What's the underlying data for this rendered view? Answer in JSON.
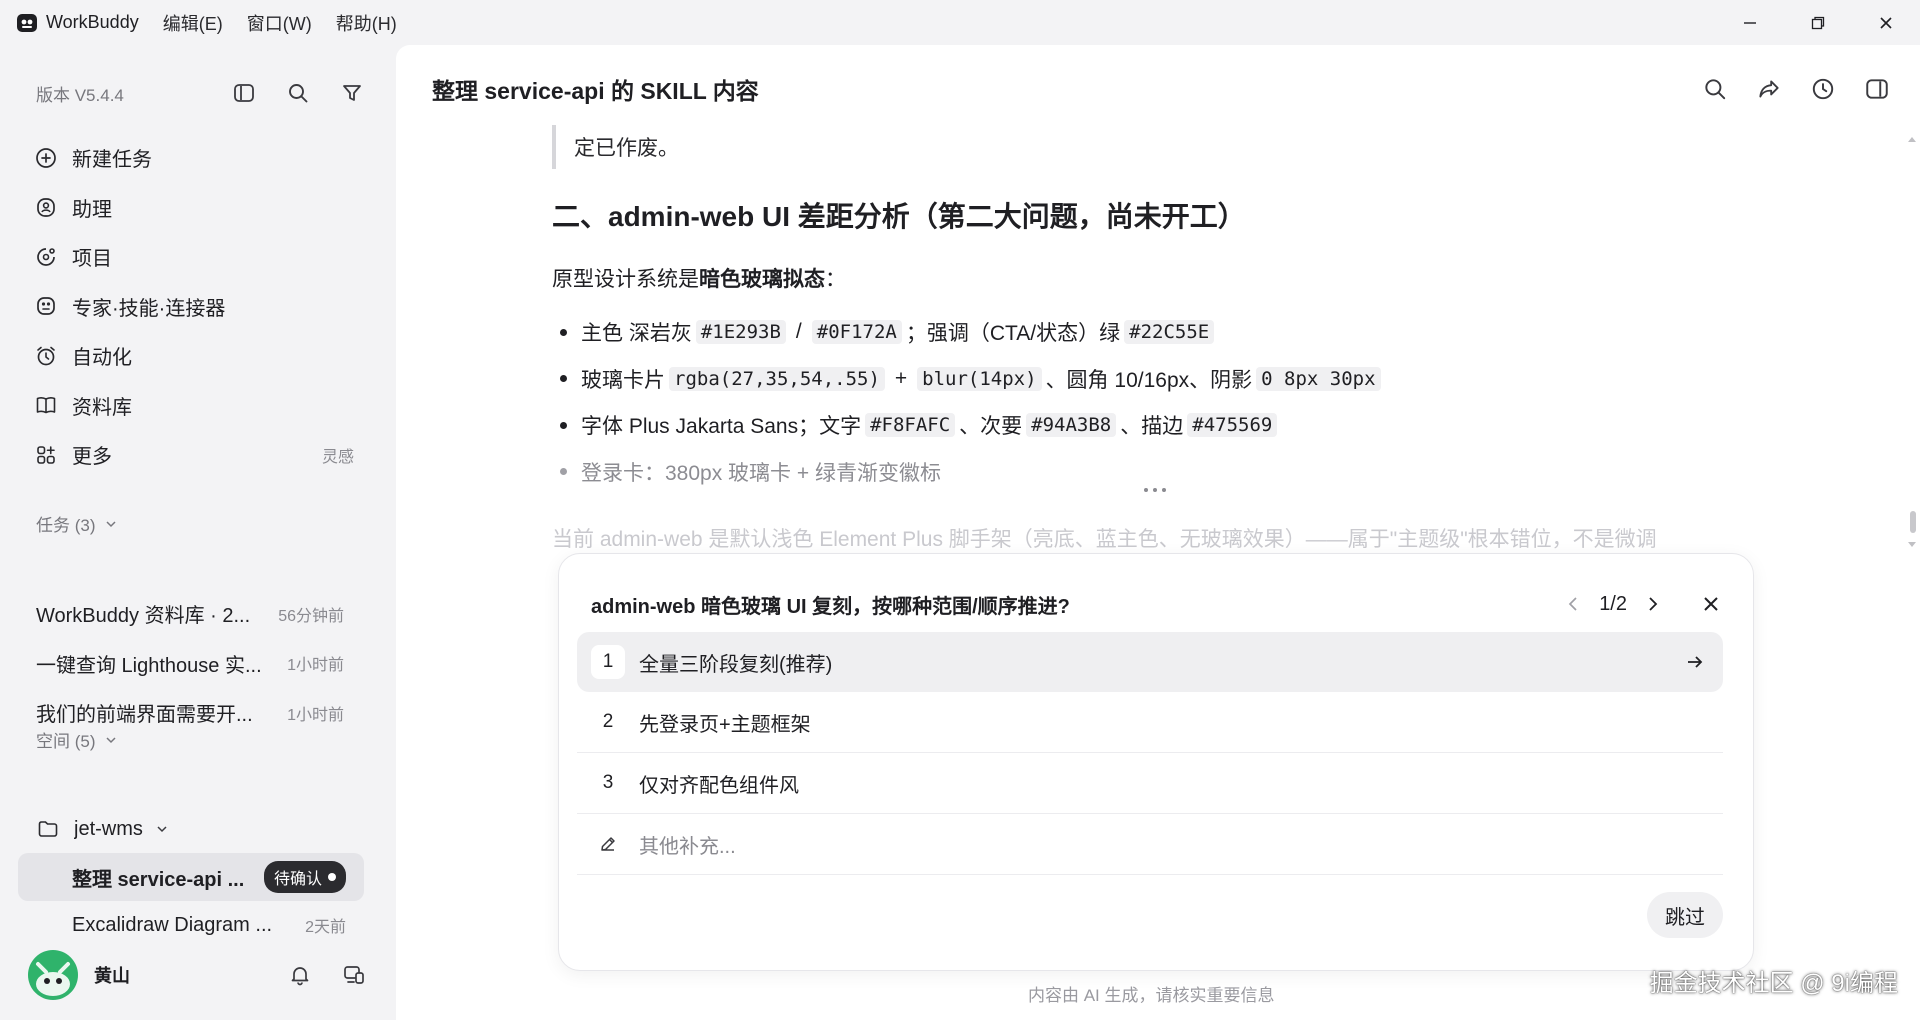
{
  "titlebar": {
    "app_name": "WorkBuddy",
    "menus": [
      "编辑(E)",
      "窗口(W)",
      "帮助(H)"
    ]
  },
  "sidebar": {
    "version": "版本 V5.4.4",
    "nav": [
      {
        "label": "新建任务",
        "icon": "plus-circle-icon"
      },
      {
        "label": "助理",
        "icon": "assistant-icon"
      },
      {
        "label": "项目",
        "icon": "project-icon"
      },
      {
        "label": "专家·技能·连接器",
        "icon": "expert-icon"
      },
      {
        "label": "自动化",
        "icon": "alarm-icon"
      },
      {
        "label": "资料库",
        "icon": "book-icon"
      },
      {
        "label": "更多",
        "icon": "apps-icon",
        "extra": "灵感"
      }
    ],
    "tasks_header": "任务 (3)",
    "tasks": [
      {
        "title": "WorkBuddy 资料库 · 2...",
        "time": "56分钟前"
      },
      {
        "title": "一键查询 Lighthouse 实...",
        "time": "1小时前"
      },
      {
        "title": "我们的前端界面需要开...",
        "time": "1小时前"
      }
    ],
    "spaces_header": "空间 (5)",
    "space": {
      "name": "jet-wms"
    },
    "space_items": [
      {
        "title": "整理 service-api ...",
        "badge": "待确认"
      },
      {
        "title": "Excalidraw Diagram ...",
        "time": "2天前"
      }
    ],
    "user": {
      "name": "黄山"
    }
  },
  "main": {
    "title": "整理 service-api 的 SKILL 内容",
    "quote_text": "定已作废。",
    "h2": "二、admin-web UI 差距分析（第二大问题，尚未开工）",
    "para_prefix": "原型设计系统是",
    "para_bold": "暗色玻璃拟态",
    "para_suffix": "：",
    "bullet1": {
      "t1": "主色 深岩灰",
      "c1": "#1E293B",
      "sep": "/",
      "c2": "#0F172A",
      "t2": "；强调（CTA/状态）绿",
      "c3": "#22C55E"
    },
    "bullet2": {
      "t1": "玻璃卡片",
      "c1": "rgba(27,35,54,.55)",
      "sep": "+",
      "c2": "blur(14px)",
      "t2": "、圆角 10/16px、阴影",
      "c3": "0 8px 30px"
    },
    "bullet3": {
      "t1": "字体 Plus Jakarta Sans；文字",
      "c1": "#F8FAFC",
      "t2": "、次要",
      "c2": "#94A3B8",
      "t3": "、描边",
      "c3": "#475569"
    },
    "bullet4": "登录卡：380px 玻璃卡 + 绿青渐变徽标",
    "faded_para": "当前 admin-web 是默认浅色 Element Plus 脚手架（亮底、蓝主色、无玻璃效果）——属于\"主题级\"根本错位，不是微调"
  },
  "question": {
    "title": "admin-web 暗色玻璃 UI 复刻，按哪种范围/顺序推进?",
    "page": "1/2",
    "options": [
      {
        "num": "1",
        "label": "全量三阶段复刻(推荐)"
      },
      {
        "num": "2",
        "label": "先登录页+主题框架"
      },
      {
        "num": "3",
        "label": "仅对齐配色组件风"
      }
    ],
    "other_placeholder": "其他补充...",
    "skip_label": "跳过"
  },
  "footnote": "内容由 AI 生成，请核实重要信息",
  "watermark": "掘金技术社区 @ 9i编程",
  "colors": {
    "accent_dark": "#2b2b2f",
    "sidebar_bg": "#f3f3f5",
    "main_bg": "#ffffff"
  }
}
